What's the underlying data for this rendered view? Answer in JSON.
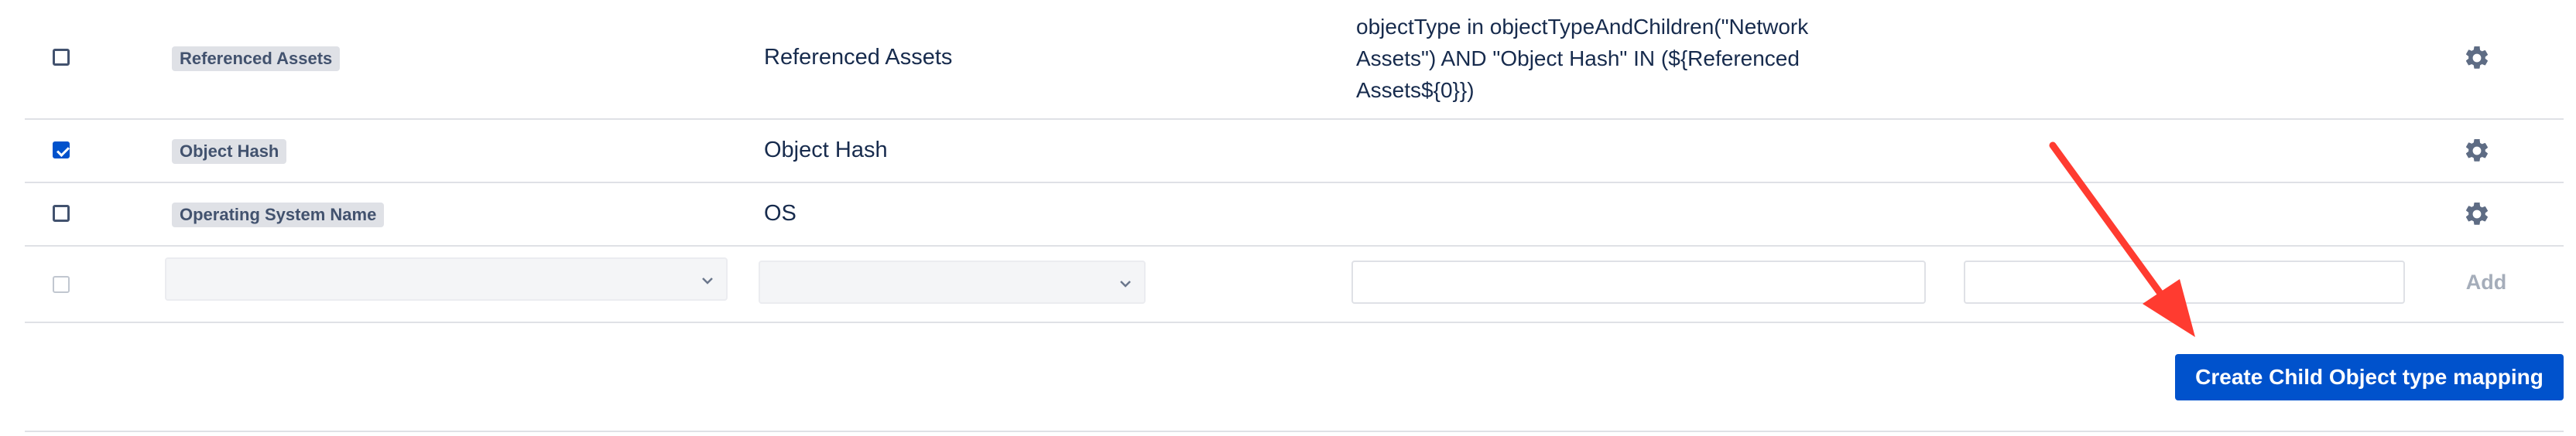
{
  "rows": [
    {
      "checked": false,
      "attribute_badge": "Referenced Assets",
      "name": "Referenced Assets",
      "query_lines": [
        "objectType in objectTypeAndChildren(\"Network",
        "Assets\") AND \"Object Hash\" IN (${Referenced",
        "Assets${0}})"
      ]
    },
    {
      "checked": true,
      "attribute_badge": "Object Hash",
      "name": "Object Hash",
      "query_lines": []
    },
    {
      "checked": false,
      "attribute_badge": "Operating System Name",
      "name": "OS",
      "query_lines": []
    }
  ],
  "new_row": {
    "add_label": "Add"
  },
  "actions": {
    "create_child_label": "Create Child Object type mapping"
  },
  "icons": {
    "row_settings": "gear-icon",
    "select_caret": "chevron-down-icon",
    "annotation": "red-arrow-annotation"
  },
  "colors": {
    "primary": "#0052cc",
    "annotation": "#ff3b30",
    "badge_bg": "#dfe1e6"
  }
}
